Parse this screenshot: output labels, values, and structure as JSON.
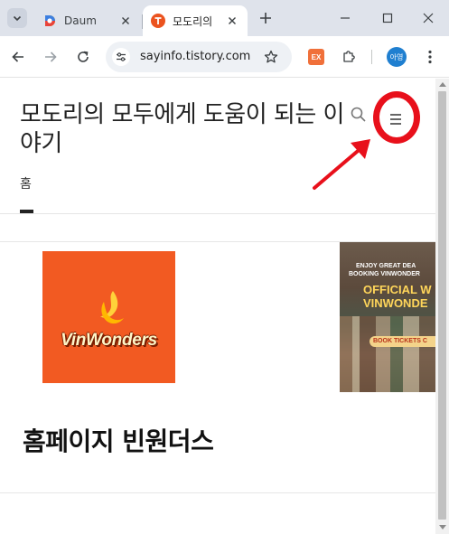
{
  "browser": {
    "tabs": [
      {
        "title": "Daum",
        "favicon": "daum-favicon",
        "active": false
      },
      {
        "title": "모도리의",
        "favicon": "tistory-favicon",
        "active": true
      }
    ],
    "url": "sayinfo.tistory.com",
    "extension_ex_label": "EX",
    "profile_label": "아영"
  },
  "blog": {
    "title": "모도리의 모두에게 도움이 되는 이야기",
    "nav": {
      "home_label": "홈"
    },
    "menu_icon": "hamburger-icon",
    "search_icon": "search-icon"
  },
  "post": {
    "thumbnail": {
      "logo_text": "VinWonders",
      "bg_color": "#f25a22"
    },
    "ad": {
      "line1": "ENJOY GREAT DEA",
      "line2": "BOOKING VINWONDER",
      "headline1": "OFFICIAL W",
      "headline2": "VINWONDE",
      "button": "BOOK TICKETS C"
    },
    "title": "홈페이지 빈원더스"
  },
  "annotation": {
    "highlight_color": "#e8101b"
  }
}
